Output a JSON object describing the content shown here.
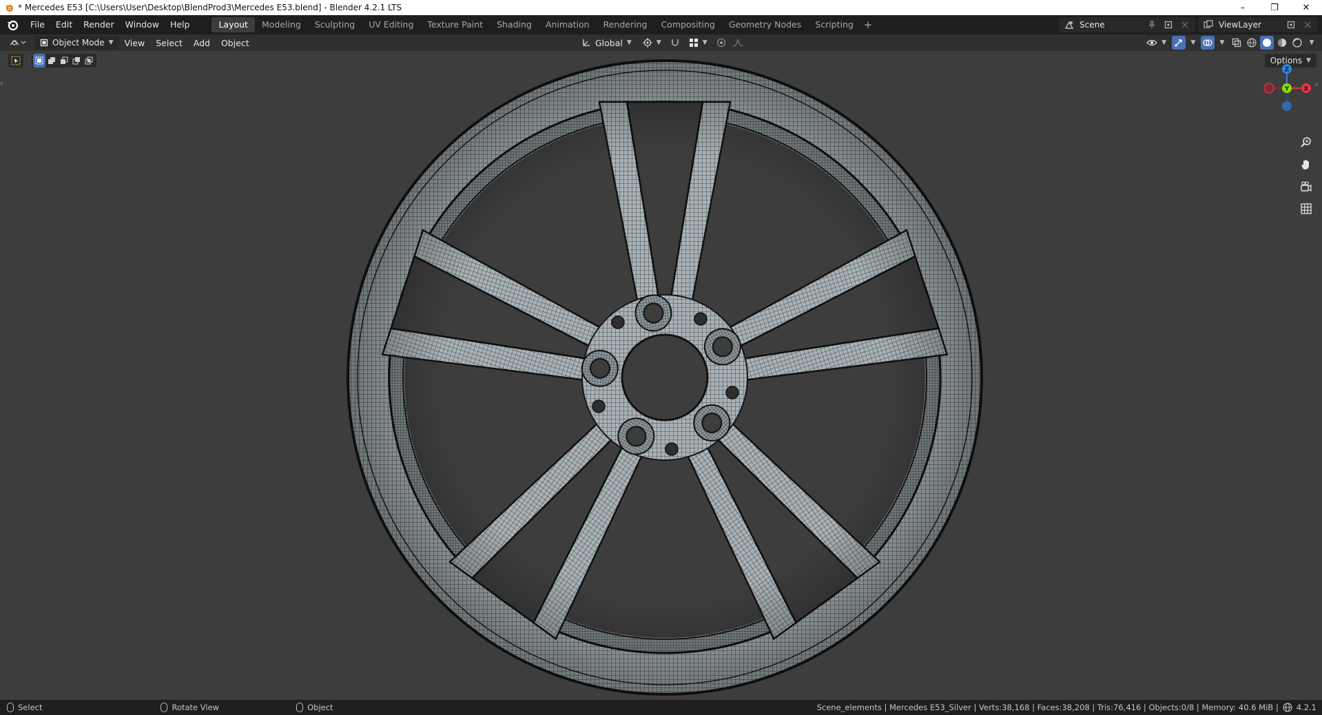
{
  "window": {
    "title": "* Mercedes E53 [C:\\Users\\User\\Desktop\\BlendProd3\\Mercedes E53.blend] - Blender 4.2.1 LTS",
    "minimize": "–",
    "maximize": "❐",
    "close": "✕"
  },
  "menu": {
    "items": [
      "File",
      "Edit",
      "Render",
      "Window",
      "Help"
    ]
  },
  "workspaces": {
    "tabs": [
      "Layout",
      "Modeling",
      "Sculpting",
      "UV Editing",
      "Texture Paint",
      "Shading",
      "Animation",
      "Rendering",
      "Compositing",
      "Geometry Nodes",
      "Scripting"
    ],
    "active": "Layout",
    "add": "+"
  },
  "scene": {
    "name": "Scene",
    "view_layer": "ViewLayer"
  },
  "viewport_header": {
    "mode": "Object Mode",
    "menus": [
      "View",
      "Select",
      "Add",
      "Object"
    ],
    "orientation": "Global"
  },
  "viewport": {
    "options_label": "Options",
    "gizmo": {
      "z": "Z",
      "y": "Y",
      "x": "X"
    },
    "background": "#3d3d3d"
  },
  "statusbar": {
    "hints": [
      "Select",
      "Rotate View",
      "Object"
    ],
    "stats": "Scene_elements | Mercedes E53_Silver | Verts:38,168 | Faces:38,208 | Tris:76,416 | Objects:0/8 | Memory: 40.6 MiB |",
    "version": "4.2.1"
  },
  "colors": {
    "accent": "#4772b3",
    "axis_x": "#e8334a",
    "axis_y": "#8bdc00",
    "axis_z": "#2f84e3"
  }
}
